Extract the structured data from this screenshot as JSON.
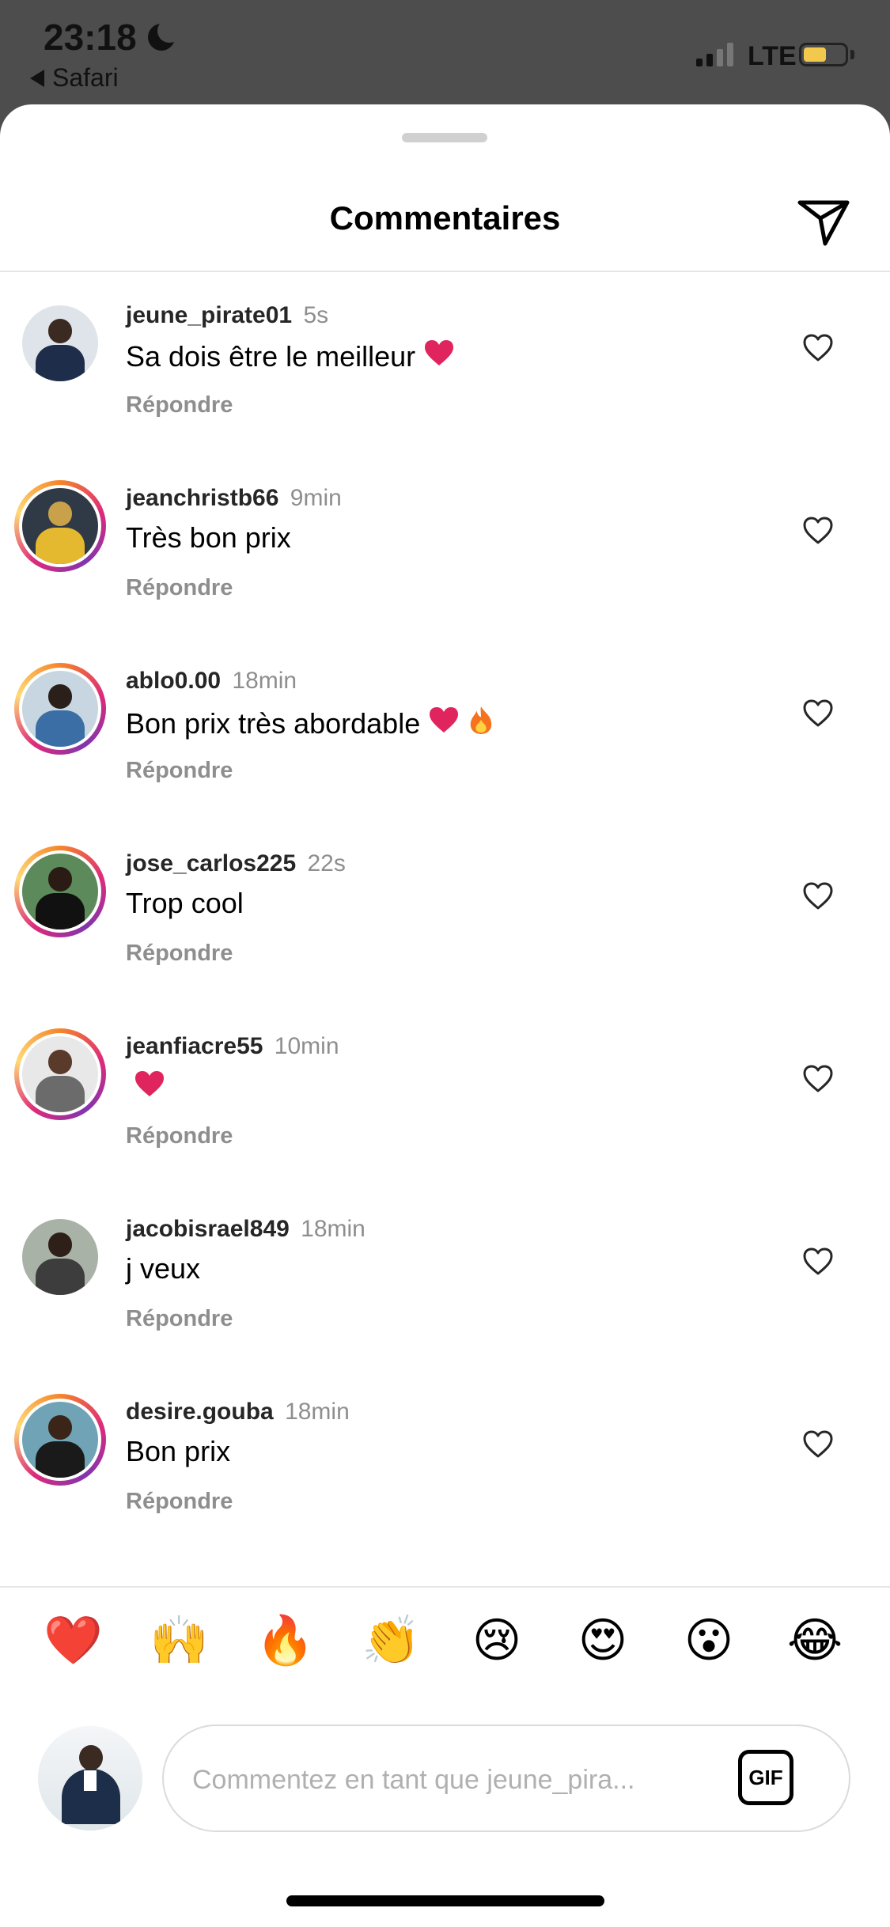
{
  "status_bar": {
    "time": "23:18",
    "back_app": "Safari",
    "network": "LTE",
    "battery_level": 0.55
  },
  "sheet": {
    "title": "Commentaires"
  },
  "comments": [
    {
      "user": "jeune_pirate01",
      "time": "5s",
      "text": "Sa dois être le meilleur",
      "emojis": [
        "heart"
      ],
      "reply": "Répondre",
      "story_ring": false
    },
    {
      "user": "jeanchristb66",
      "time": "9min",
      "text": "Très bon prix",
      "emojis": [],
      "reply": "Répondre",
      "story_ring": true
    },
    {
      "user": "ablo0.00",
      "time": "18min",
      "text": "Bon prix très abordable",
      "emojis": [
        "heart",
        "fire"
      ],
      "reply": "Répondre",
      "story_ring": true
    },
    {
      "user": "jose_carlos225",
      "time": "22s",
      "text": "Trop cool",
      "emojis": [],
      "reply": "Répondre",
      "story_ring": true
    },
    {
      "user": "jeanfiacre55",
      "time": "10min",
      "text": "",
      "emojis": [
        "heart"
      ],
      "reply": "Répondre",
      "story_ring": true
    },
    {
      "user": "jacobisrael849",
      "time": "18min",
      "text": "j veux",
      "emojis": [],
      "reply": "Répondre",
      "story_ring": false
    },
    {
      "user": "desire.gouba",
      "time": "18min",
      "text": "Bon prix",
      "emojis": [],
      "reply": "Répondre",
      "story_ring": true
    }
  ],
  "reactions": [
    "❤️",
    "🙌",
    "🔥",
    "👏",
    "😢",
    "😍",
    "😮",
    "😂"
  ],
  "composer": {
    "placeholder": "Commentez en tant que jeune_pira...",
    "gif_label": "GIF"
  },
  "icons": {
    "send": "paper-plane-icon",
    "like": "heart-outline-icon"
  },
  "colors": {
    "heart_red": "#e0245e",
    "muted": "#8e8e8e",
    "ring_start": "#f58529",
    "ring_mid": "#dd2a7b"
  }
}
